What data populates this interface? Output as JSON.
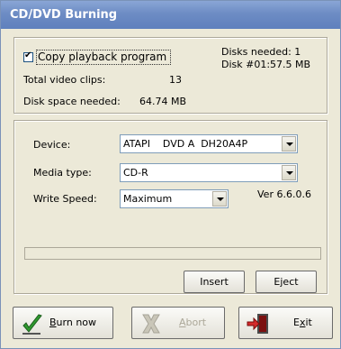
{
  "window": {
    "title": "CD/DVD Burning"
  },
  "summary": {
    "copy_playback_label": "Copy playback program",
    "copy_playback_checked": true,
    "disks_needed": "Disks needed: 1",
    "disk_info": "Disk #01:57.5 MB",
    "total_clips_label": "Total video clips:",
    "total_clips_value": "13",
    "disk_space_label": "Disk space needed:",
    "disk_space_value": "64.74 MB"
  },
  "device": {
    "device_label": "Device:",
    "device_value": "ATAPI    DVD A  DH20A4P",
    "media_label": "Media type:",
    "media_value": "CD-R",
    "speed_label": "Write Speed:",
    "speed_value": "Maximum",
    "version": "Ver 6.6.0.6",
    "progress": 0
  },
  "buttons": {
    "insert": "Insert",
    "eject": "Eject",
    "burn": "Burn now",
    "abort": "Abort",
    "exit": "Exit"
  },
  "icons": {
    "burn": "checkmark-icon",
    "abort": "abort-x-icon",
    "exit": "exit-door-icon"
  }
}
